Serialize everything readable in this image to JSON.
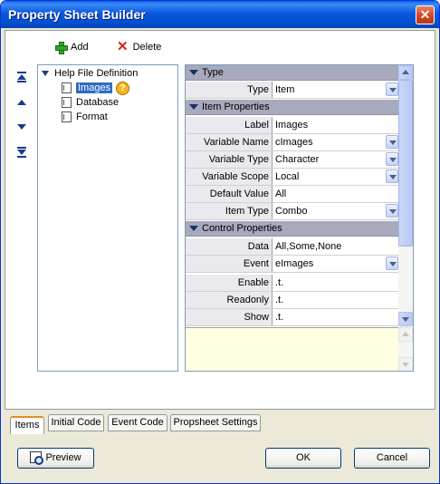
{
  "window": {
    "title": "Property Sheet Builder",
    "close_symbol": "✕"
  },
  "toolbar": {
    "add_label": "Add",
    "delete_label": "Delete"
  },
  "tree": {
    "root_label": "Help File Definition",
    "items": [
      {
        "label": "Images",
        "selected": true
      },
      {
        "label": "Database",
        "selected": false
      },
      {
        "label": "Format",
        "selected": false
      }
    ],
    "help_badge": "?"
  },
  "sections": {
    "type": "Type",
    "item_properties": "Item Properties",
    "control_properties": "Control Properties"
  },
  "properties": {
    "type": {
      "label": "Type",
      "value": "Item"
    },
    "label": {
      "label": "Label",
      "value": "Images"
    },
    "variable_name": {
      "label": "Variable Name",
      "value": "cImages"
    },
    "variable_type": {
      "label": "Variable Type",
      "value": "Character"
    },
    "variable_scope": {
      "label": "Variable Scope",
      "value": "Local"
    },
    "default_value": {
      "label": "Default Value",
      "value": "All"
    },
    "item_type": {
      "label": "Item Type",
      "value": "Combo"
    },
    "data": {
      "label": "Data",
      "value": "All,Some,None"
    },
    "event": {
      "label": "Event",
      "value": "eImages"
    },
    "enable": {
      "label": "Enable",
      "value": ".t."
    },
    "readonly": {
      "label": "Readonly",
      "value": ".t."
    },
    "show": {
      "label": "Show",
      "value": ".t."
    }
  },
  "tabs": [
    "Items",
    "Initial Code",
    "Event Code",
    "Propsheet Settings"
  ],
  "buttons": {
    "preview": "Preview",
    "ok": "OK",
    "cancel": "Cancel"
  },
  "icons": {
    "add": "plus-icon",
    "delete": "x-icon",
    "move_top": "move-top-icon",
    "move_up": "move-up-icon",
    "move_down": "move-down-icon",
    "move_bottom": "move-bottom-icon",
    "preview": "preview-icon"
  },
  "colors": {
    "titlebar": "#0a58e0",
    "selection": "#316ac5",
    "section_header": "#a7a9bc",
    "note_area": "#ffffe1",
    "active_tab_accent": "#e68b2c"
  }
}
